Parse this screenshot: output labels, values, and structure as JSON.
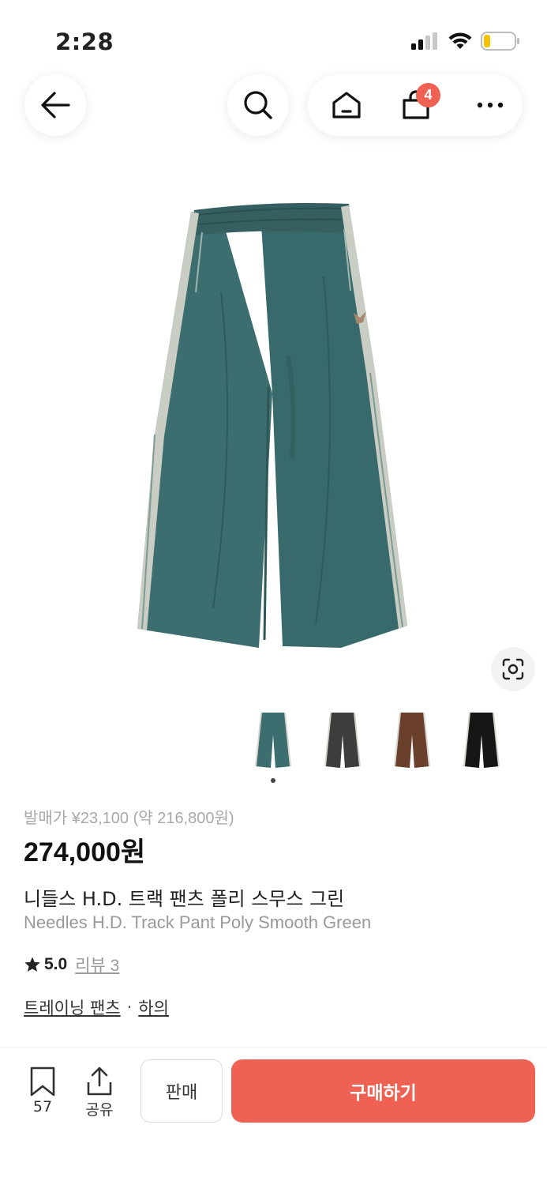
{
  "status_bar": {
    "time": "2:28"
  },
  "header": {
    "cart_count": "4"
  },
  "product": {
    "release_price": "발매가 ¥23,100 (약 216,800원)",
    "price": "274,000원",
    "name_ko": "니들스 H.D. 트랙 팬츠 폴리 스무스 그린",
    "name_en": "Needles H.D. Track Pant Poly Smooth Green",
    "rating": "5.0",
    "reviews": "리뷰 3",
    "categories": [
      "트레이닝 팬츠",
      "하의"
    ],
    "category_separator": "·",
    "thumbnails": [
      "green",
      "charcoal",
      "brown",
      "black"
    ],
    "thumbnail_colors": [
      "#3c6e6f",
      "#3d3d3d",
      "#6a3f2c",
      "#161616"
    ],
    "selected_thumbnail_index": 0
  },
  "bottom_bar": {
    "wishlist_count": "57",
    "share_label": "공유",
    "sell_label": "판매",
    "buy_label": "구매하기"
  },
  "colors": {
    "accent": "#ef6253",
    "product_green": "#3c6e6f"
  }
}
